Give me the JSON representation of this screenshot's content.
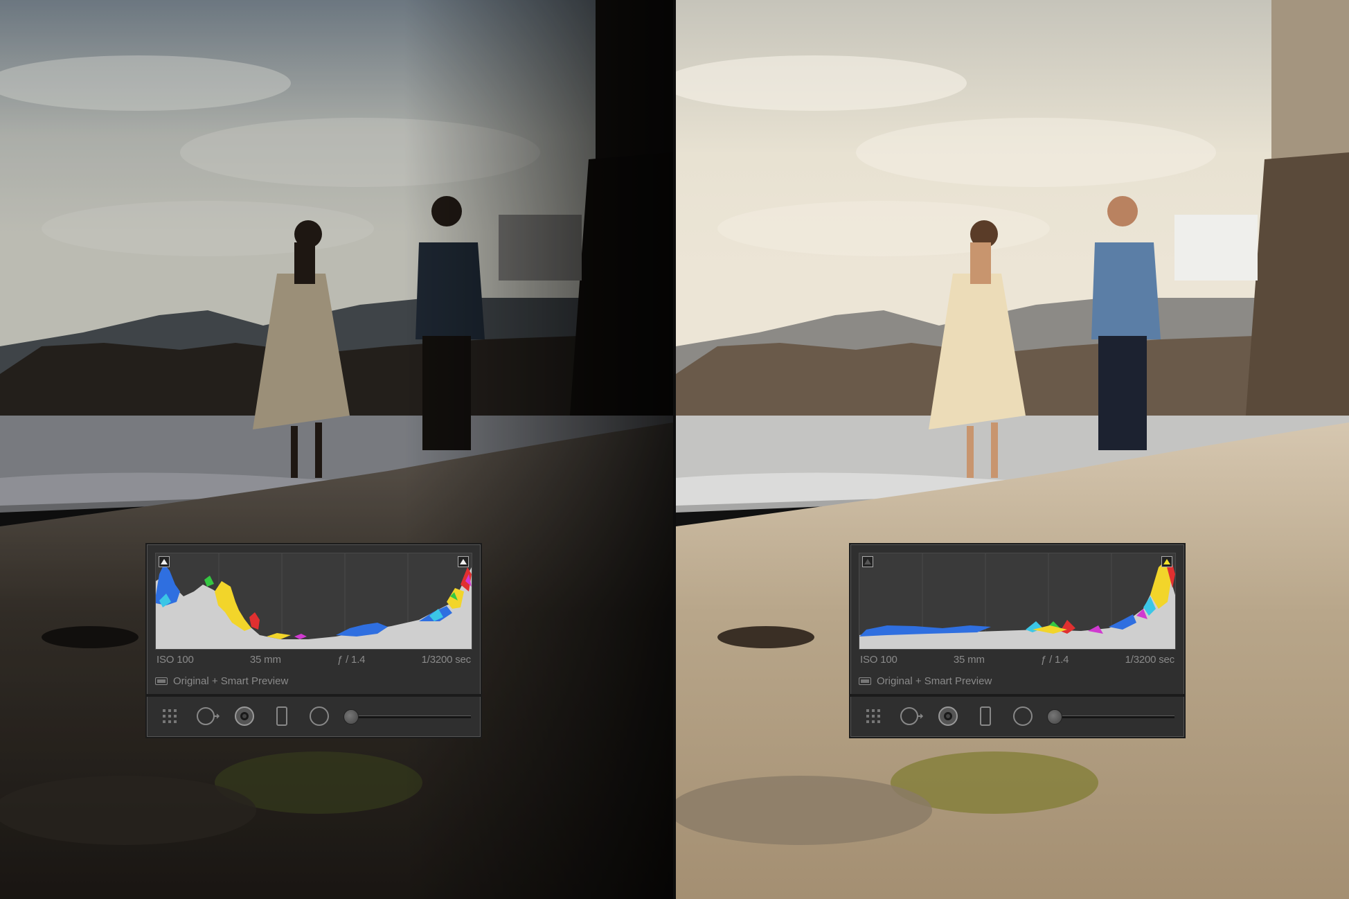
{
  "panels": {
    "before": {
      "exif": {
        "iso": "ISO 100",
        "focal": "35 mm",
        "aperture": "ƒ / 1.4",
        "shutter": "1/3200 sec"
      },
      "preview_status": "Original + Smart Preview",
      "clipping": {
        "shadows": "on",
        "highlights": "on"
      },
      "histogram_colors": {
        "blue": "#2f6fe0",
        "yellow": "#f2d52a",
        "red": "#e03030",
        "magenta": "#d03ad0",
        "cyan": "#3bc6e6",
        "green": "#35c742",
        "gray": "#c9c9c9"
      }
    },
    "after": {
      "exif": {
        "iso": "ISO 100",
        "focal": "35 mm",
        "aperture": "ƒ / 1.4",
        "shutter": "1/3200 sec"
      },
      "preview_status": "Original + Smart Preview",
      "clipping": {
        "shadows": "off",
        "highlights": "warning"
      },
      "histogram_colors": {
        "blue": "#2f6fe0",
        "yellow": "#f2d52a",
        "red": "#e03030",
        "magenta": "#d03ad0",
        "cyan": "#3bc6e6",
        "green": "#35c742",
        "gray": "#c9c9c9"
      }
    }
  },
  "toolbar_icons": [
    "grid-overlay-icon",
    "crop-overlay-icon",
    "spot-removal-icon",
    "red-eye-icon",
    "graduated-filter-icon",
    "radial-filter-icon",
    "adjustment-brush-icon"
  ],
  "colors": {
    "panel_bg": "#2f2f2f",
    "panel_text": "#8a8a8a",
    "warning_yellow": "#f1e02a"
  }
}
